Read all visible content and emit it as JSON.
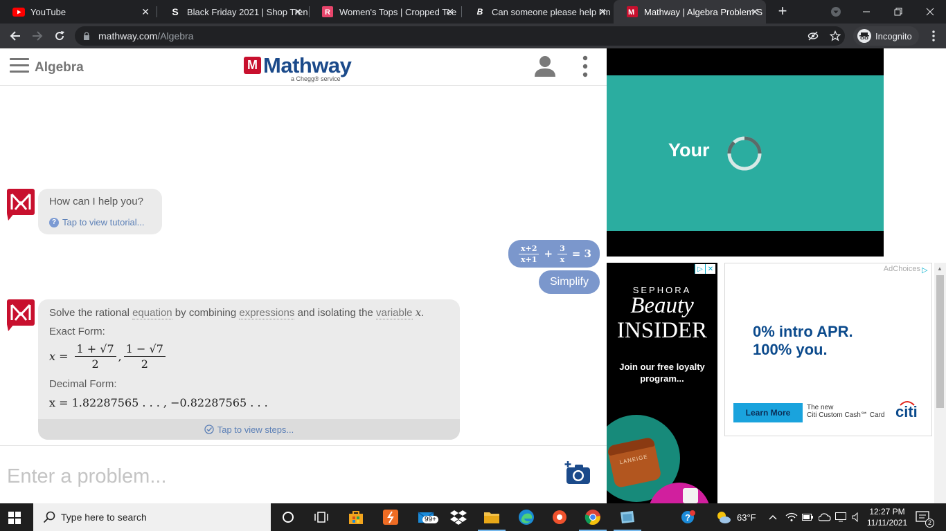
{
  "browser": {
    "tabs": [
      {
        "title": "YouTube",
        "favicon": "youtube-icon"
      },
      {
        "title": "Black Friday 2021 | Shop Tren",
        "favicon": "shein-icon"
      },
      {
        "title": "Women's Tops | Cropped Tee",
        "favicon": "romwe-icon"
      },
      {
        "title": "Can someone please help I'm",
        "favicon": "brainly-icon"
      },
      {
        "title": "Mathway | Algebra Problem S",
        "favicon": "mathway-icon",
        "active": true
      }
    ],
    "url_host": "mathway.com",
    "url_path": "/Algebra",
    "profile_label": "Incognito"
  },
  "header": {
    "subject": "Algebra",
    "logo_word": "Mathway",
    "logo_tagline": "a Chegg® service"
  },
  "chat": {
    "greeting": "How can I help you?",
    "tutorial_link": "Tap to view tutorial...",
    "user_problem": {
      "frac1_num": "x+2",
      "frac1_den": "x+1",
      "plus": "+",
      "frac2_num": "3",
      "frac2_den": "x",
      "rhs": "= 3"
    },
    "user_action": "Simplify",
    "answer": {
      "intro_1": "Solve the rational ",
      "term_equation": "equation",
      "intro_2": " by combining ",
      "term_expressions": "expressions",
      "intro_3": " and isolating the ",
      "term_variable": "variable",
      "intro_var": "x",
      "intro_end": ".",
      "exact_label": "Exact Form:",
      "exact_prefix": "x =",
      "exact_num1": "1 + √7",
      "exact_num2": "1 − √7",
      "exact_den": "2",
      "exact_sep": ",",
      "decimal_label": "Decimal Form:",
      "decimal_value": "x = 1.82287565 . . . , −0.82287565 . . .",
      "steps_link": "Tap to view steps..."
    }
  },
  "input": {
    "placeholder": "Enter a problem..."
  },
  "ads": {
    "video_text": "Your",
    "sephora": {
      "brand": "SEPHORA",
      "title_1": "Beauty",
      "title_2": "INSIDER",
      "cta": "Join our free loyalty program...",
      "product_label": "LANEIGE"
    },
    "citi": {
      "adchoices": "AdChoices",
      "headline_1": "0% intro APR.",
      "headline_2": "100% you.",
      "button": "Learn More",
      "fine_1": "The new",
      "fine_2": "Citi Custom Cash℠ Card",
      "logo": "citi"
    }
  },
  "taskbar": {
    "search_placeholder": "Type here to search",
    "mail_badge": "99+",
    "weather": "63°F",
    "time": "12:27 PM",
    "date": "11/11/2021",
    "notifications": "2"
  }
}
